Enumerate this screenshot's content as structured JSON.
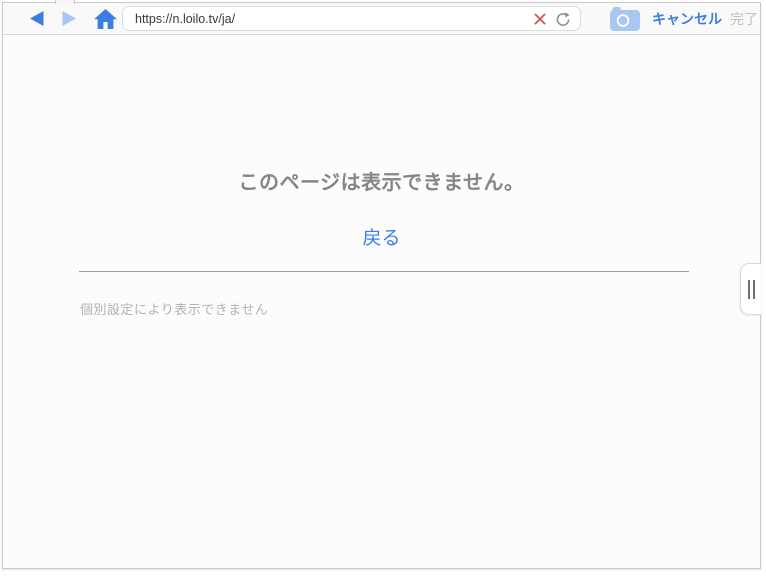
{
  "toolbar": {
    "url": "https://n.loilo.tv/ja/",
    "cancel_label": "キャンセル",
    "done_label": "完了",
    "icons": {
      "back": "back-arrow-icon",
      "forward": "forward-arrow-icon",
      "home": "home-icon",
      "stop": "stop-x-icon",
      "reload": "reload-icon",
      "camera": "camera-icon"
    }
  },
  "content": {
    "error_title": "このページは表示できません。",
    "back_link_label": "戻る",
    "note": "個別設定により表示できません"
  },
  "side_handle": {
    "icon": "drawer-handle-icon"
  },
  "colors": {
    "accent_blue": "#3b7de2",
    "link_blue": "#3b7cf0",
    "disabled_forward_blue": "#a9c6f0",
    "camera_blue": "#a9c7f0",
    "stop_red": "#dd5149",
    "title_gray": "#85858a",
    "note_gray": "#b2b2b5",
    "done_gray": "#bdc1c6",
    "divider_gray": "#9c9c9e"
  }
}
